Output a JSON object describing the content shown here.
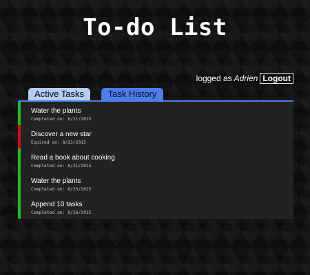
{
  "app": {
    "title": "To-do List"
  },
  "user": {
    "prefix": "logged as",
    "name": "Adrien",
    "logout_label": "Logout"
  },
  "tabs": [
    {
      "label": "Active Tasks"
    },
    {
      "label": "Task History"
    }
  ],
  "colors": {
    "completed": "#22bb22",
    "expired": "#cc1111",
    "tab_active": "#b3cdf5",
    "tab_history": "#4d7dea"
  },
  "tasks": [
    {
      "name": "Water the plants",
      "meta": "Completed on: 8/21/2015",
      "status": "completed"
    },
    {
      "name": "Discover a new star",
      "meta": "Expired on: 8/23/2015",
      "status": "expired"
    },
    {
      "name": "Read a book about cooking",
      "meta": "Completed on: 8/21/2015",
      "status": "completed"
    },
    {
      "name": "Water the plants",
      "meta": "Completed on: 8/25/2015",
      "status": "completed"
    },
    {
      "name": "Append 10 tasks",
      "meta": "Completed on: 8/26/2015",
      "status": "completed"
    }
  ]
}
